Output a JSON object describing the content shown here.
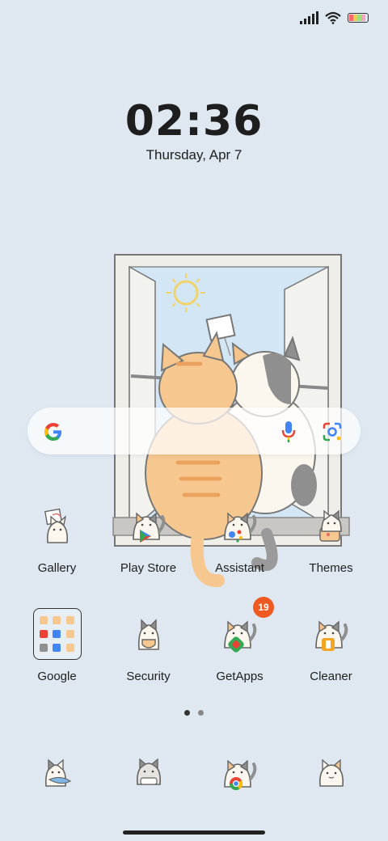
{
  "status_bar": {
    "icons": [
      "signal-icon",
      "wifi-icon",
      "battery-icon"
    ]
  },
  "lockscreen": {
    "time": "02:36",
    "date": "Thursday, Apr 7"
  },
  "search_bar": {
    "icons": [
      "google-g-icon",
      "mic-icon",
      "google-lens-icon"
    ]
  },
  "apps_row1": [
    {
      "label": "Gallery",
      "icon": "cat-gallery-icon"
    },
    {
      "label": "Play Store",
      "icon": "cat-play-store-icon"
    },
    {
      "label": "Assistant",
      "icon": "cat-assistant-icon"
    },
    {
      "label": "Themes",
      "icon": "cat-themes-icon"
    }
  ],
  "apps_row2": [
    {
      "label": "Google",
      "icon": "google-folder-icon"
    },
    {
      "label": "Security",
      "icon": "cat-security-icon"
    },
    {
      "label": "GetApps",
      "icon": "cat-getapps-icon",
      "badge": "19"
    },
    {
      "label": "Cleaner",
      "icon": "cat-cleaner-icon"
    }
  ],
  "dock": [
    {
      "icon": "cat-phone-icon"
    },
    {
      "icon": "cat-messages-icon"
    },
    {
      "icon": "cat-chrome-icon"
    },
    {
      "icon": "cat-camera-icon"
    }
  ],
  "page_indicator": {
    "pages": 2,
    "current": 1
  },
  "colors": {
    "background": "#dfe8f1",
    "badge": "#f05a22",
    "cat_orange": "#f6c890",
    "cat_white": "#fbf7ef"
  }
}
